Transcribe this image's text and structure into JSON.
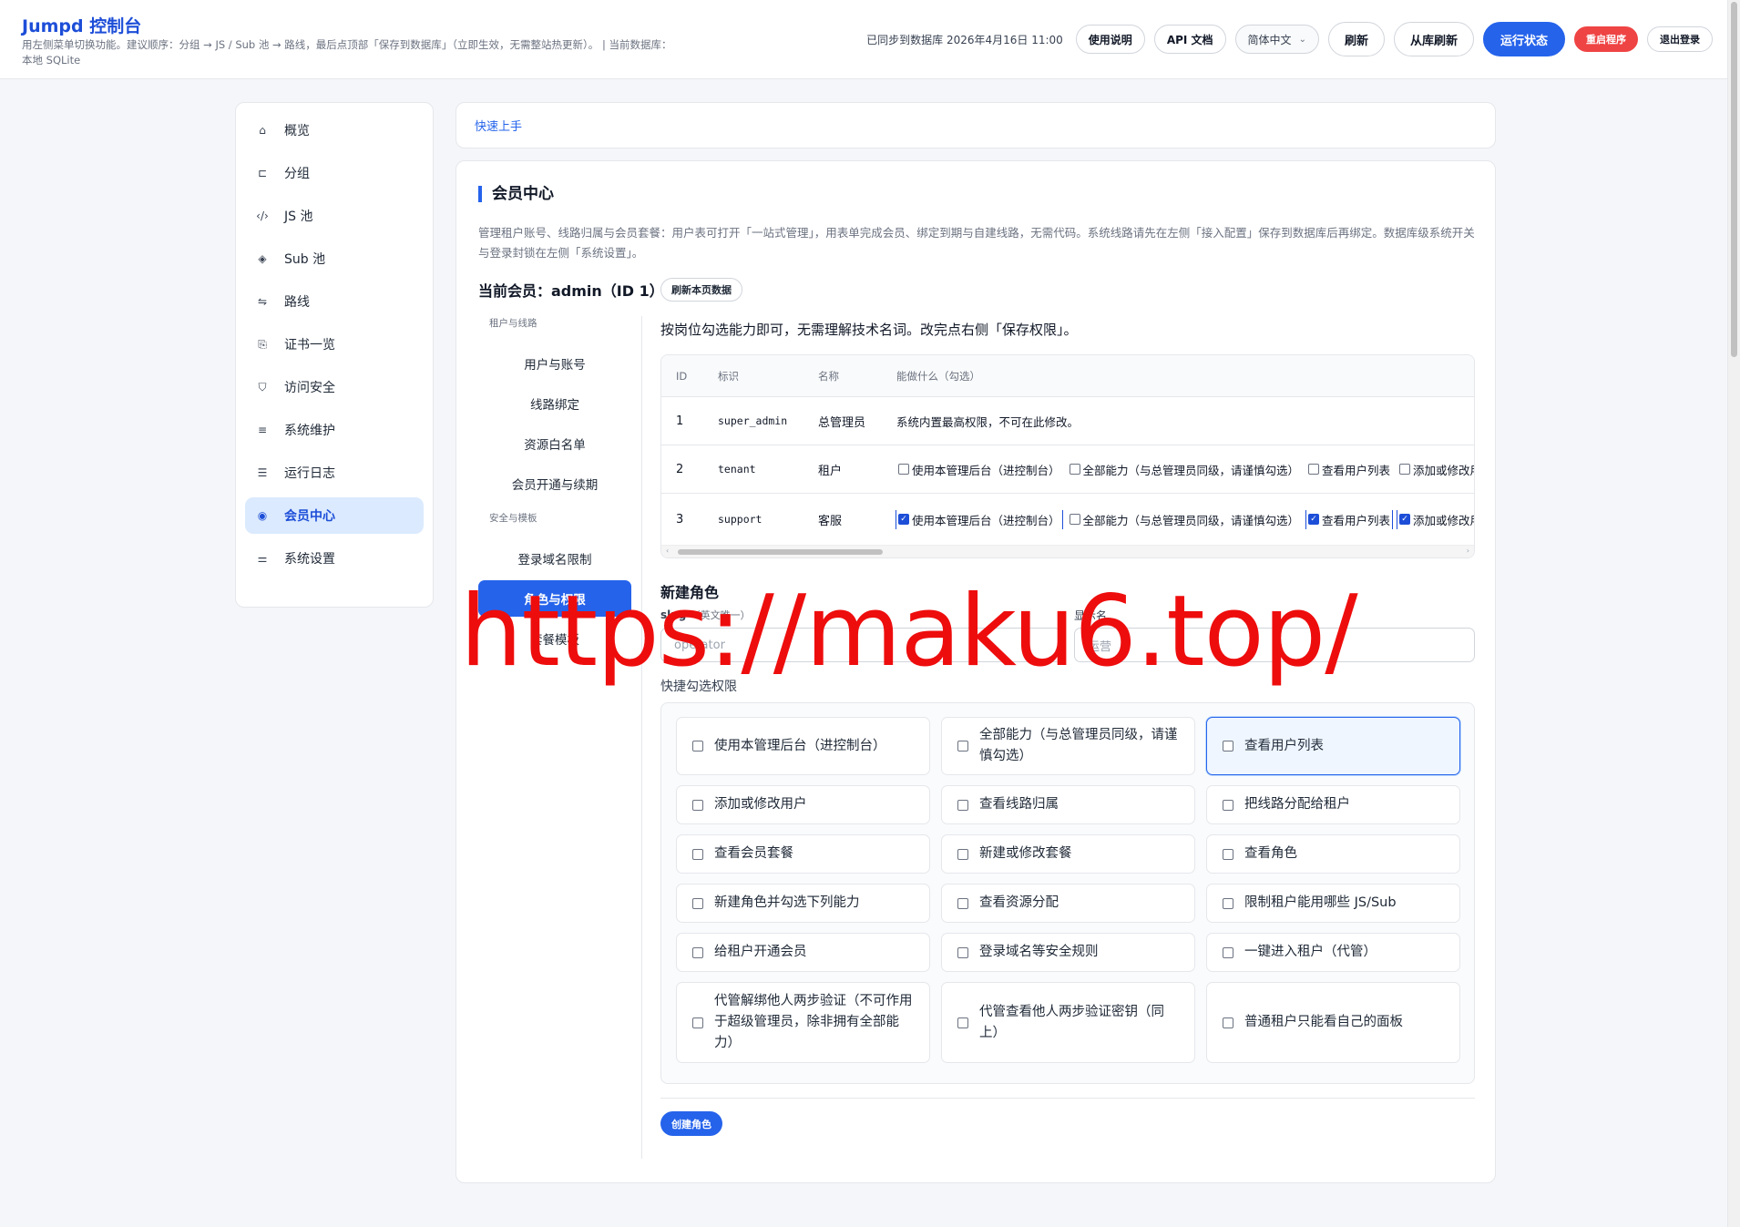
{
  "header": {
    "title": "Jumpd 控制台",
    "desc": "用左侧菜单切换功能。建议顺序：分组 → JS / Sub 池 → 路线，最后点顶部「保存到数据库」（立即生效，无需整站热更新）。 | 当前数据库：本地 SQLite",
    "sync_status": "已同步到数据库 2026年4月16日 11:00",
    "buttons": {
      "help": "使用说明",
      "api": "API 文档",
      "lang": "简体中文",
      "refresh": "刷新",
      "reload_db": "从库刷新",
      "status": "运行状态",
      "restart": "重启程序",
      "logout": "退出登录"
    }
  },
  "sidebar": {
    "items": [
      {
        "label": "概览",
        "icon": "home-icon"
      },
      {
        "label": "分组",
        "icon": "group-icon"
      },
      {
        "label": "JS 池",
        "icon": "code-icon"
      },
      {
        "label": "Sub 池",
        "icon": "layers-icon"
      },
      {
        "label": "路线",
        "icon": "route-icon"
      },
      {
        "label": "证书一览",
        "icon": "certificate-icon"
      },
      {
        "label": "访问安全",
        "icon": "shield-icon"
      },
      {
        "label": "系统维护",
        "icon": "database-icon"
      },
      {
        "label": "运行日志",
        "icon": "log-icon"
      },
      {
        "label": "会员中心",
        "icon": "user-circle-icon"
      },
      {
        "label": "系统设置",
        "icon": "sliders-icon"
      }
    ]
  },
  "quick_start": "快速上手",
  "section": {
    "title": "会员中心",
    "desc": "管理租户账号、线路归属与会员套餐：用户表可打开「一站式管理」，用表单完成会员、绑定到期与自建线路，无需代码。系统线路请先在左侧「接入配置」保存到数据库后再绑定。数据库级系统开关与登录封锁在左侧「系统设置」。",
    "current_member": "当前会员：admin（ID 1）",
    "refresh_page": "刷新本页数据"
  },
  "subnav": {
    "group1": "租户与线路",
    "items1": [
      "用户与账号",
      "线路绑定",
      "资源白名单",
      "会员开通与续期"
    ],
    "group2": "安全与模板",
    "items2": [
      "登录域名限制",
      "角色与权限",
      "套餐模板"
    ]
  },
  "roles": {
    "hint": "按岗位勾选能力即可，无需理解技术名词。改完点右侧「保存权限」。",
    "columns": {
      "id": "ID",
      "slug": "标识",
      "name": "名称",
      "caps": "能做什么（勾选）"
    },
    "rows": [
      {
        "id": "1",
        "slug": "super_admin",
        "name": "总管理员",
        "text": "系统内置最高权限，不可在此修改。"
      },
      {
        "id": "2",
        "slug": "tenant",
        "name": "租户",
        "caps": [
          {
            "label": "使用本管理后台（进控制台）",
            "checked": false
          },
          {
            "label": "全部能力（与总管理员同级，请谨慎勾选）",
            "checked": false
          },
          {
            "label": "查看用户列表",
            "checked": false
          },
          {
            "label": "添加或修改用户",
            "checked": false
          }
        ]
      },
      {
        "id": "3",
        "slug": "support",
        "name": "客服",
        "caps": [
          {
            "label": "使用本管理后台（进控制台）",
            "checked": true
          },
          {
            "label": "全部能力（与总管理员同级，请谨慎勾选）",
            "checked": false
          },
          {
            "label": "查看用户列表",
            "checked": true
          },
          {
            "label": "添加或修改用户",
            "checked": true
          }
        ]
      }
    ]
  },
  "new_role": {
    "title": "新建角色",
    "slug_label": "slug",
    "slug_sub": "（英文唯一）",
    "slug_placeholder": "operator",
    "display_label": "显示名",
    "display_placeholder": "运营",
    "quick_label": "快捷勾选权限",
    "options": [
      "使用本管理后台（进控制台）",
      "全部能力（与总管理员同级，请谨慎勾选）",
      "查看用户列表",
      "添加或修改用户",
      "查看线路归属",
      "把线路分配给租户",
      "查看会员套餐",
      "新建或修改套餐",
      "查看角色",
      "新建角色并勾选下列能力",
      "查看资源分配",
      "限制租户能用哪些 JS/Sub",
      "给租户开通会员",
      "登录域名等安全规则",
      "一键进入租户（代管）",
      "代管解绑他人两步验证（不可作用于超级管理员，除非拥有全部能力）",
      "代管查看他人两步验证密钥（同上）",
      "普通租户只能看自己的面板"
    ],
    "focused_option": 2,
    "create_button": "创建角色"
  },
  "watermark": "https://maku6.top/",
  "colors": {
    "accent": "#2563eb",
    "danger": "#ef4444",
    "watermark": "#ee0d0d"
  }
}
